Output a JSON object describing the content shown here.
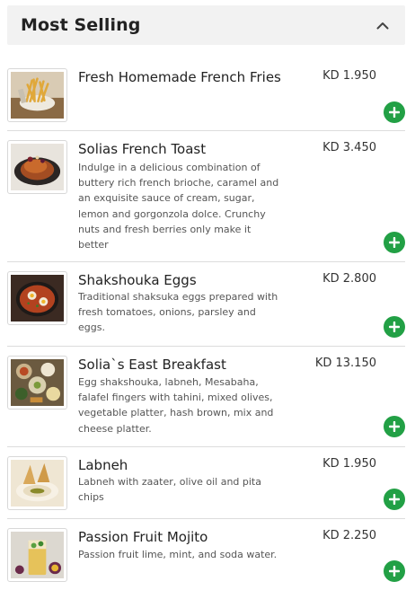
{
  "section": {
    "title": "Most Selling",
    "collapse_icon": "chevron-up-icon"
  },
  "add_icon": "plus-icon",
  "colors": {
    "add_button": "#22a045",
    "header_bg": "#f2f2f2",
    "divider": "#dcdcdc"
  },
  "items": [
    {
      "name": "Fresh Homemade French Fries",
      "price": "KD 1.950",
      "description": ""
    },
    {
      "name": "Solias French Toast",
      "price": "KD 3.450",
      "description": "Indulge in a delicious combination of buttery rich french brioche, caramel and an exquisite sauce of cream, sugar, lemon and gorgonzola dolce. Crunchy nuts and fresh berries only make it better"
    },
    {
      "name": "Shakshouka Eggs",
      "price": "KD 2.800",
      "description": "Traditional shaksuka eggs prepared with fresh tomatoes, onions, parsley and eggs."
    },
    {
      "name": "Solia`s East Breakfast",
      "price": "KD 13.150",
      "description": "Egg shakshouka, labneh, Mesabaha, falafel fingers with tahini, mixed olives, vegetable platter, hash brown, mix and cheese platter."
    },
    {
      "name": "Labneh",
      "price": "KD 1.950",
      "description": "Labneh with zaater, olive oil and pita chips"
    },
    {
      "name": "Passion Fruit Mojito",
      "price": "KD 2.250",
      "description": "Passion fruit lime, mint, and soda water."
    }
  ]
}
